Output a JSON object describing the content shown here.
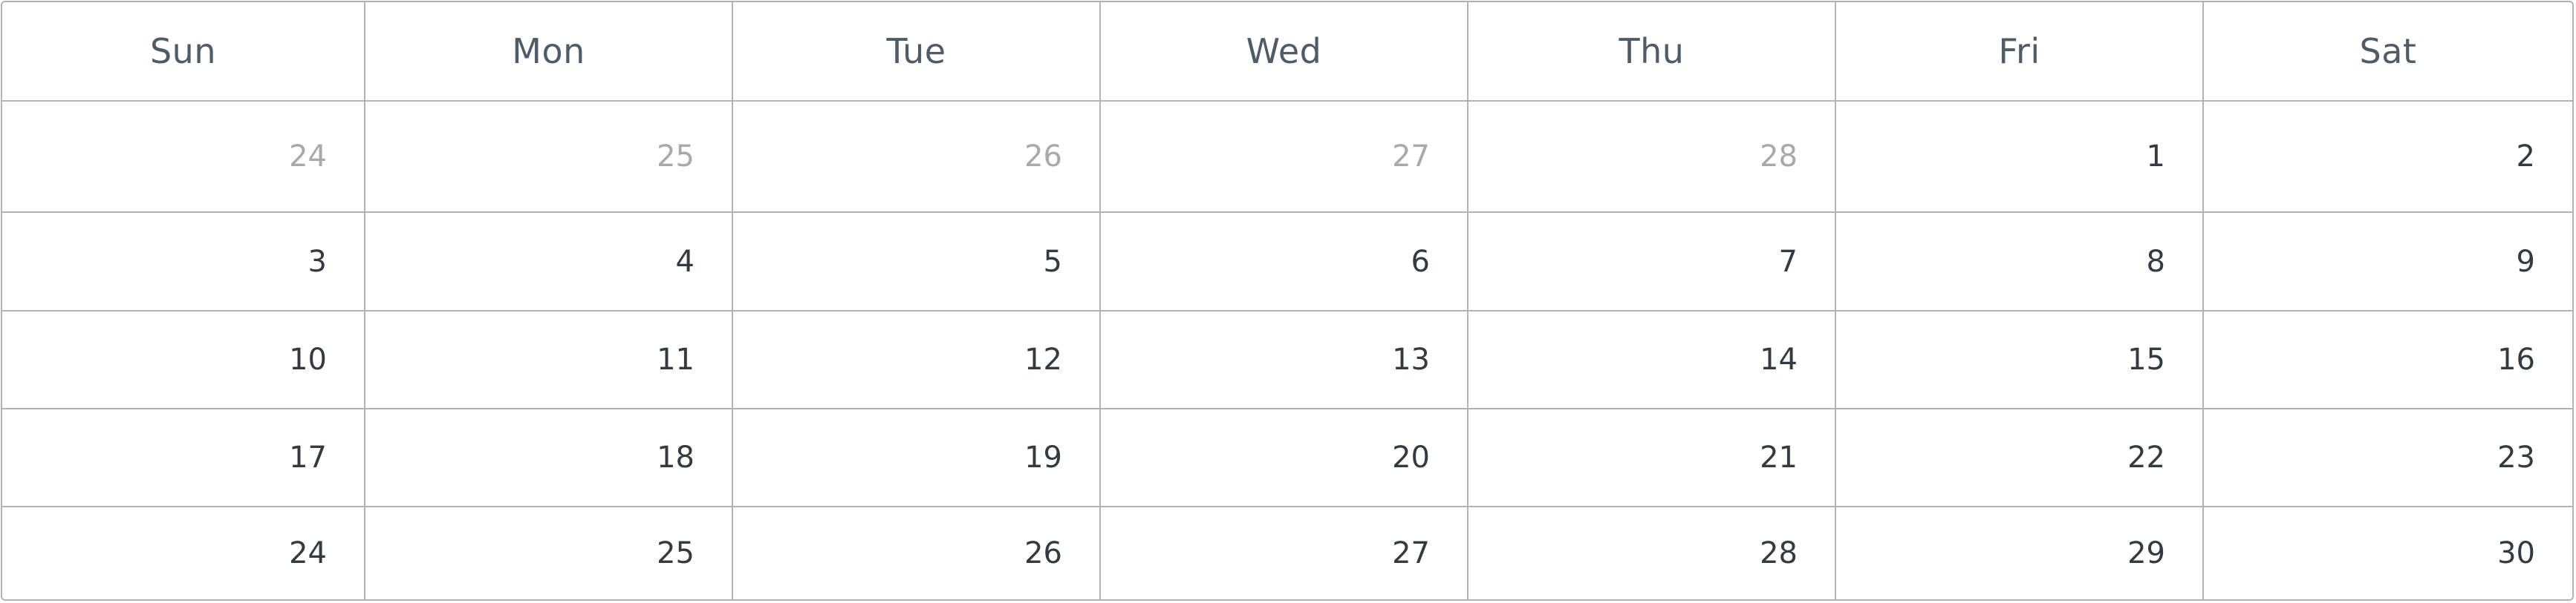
{
  "calendar": {
    "weekdays": [
      "Sun",
      "Mon",
      "Tue",
      "Wed",
      "Thu",
      "Fri",
      "Sat"
    ],
    "weeks": [
      [
        {
          "day": "24",
          "muted": true
        },
        {
          "day": "25",
          "muted": true
        },
        {
          "day": "26",
          "muted": true
        },
        {
          "day": "27",
          "muted": true
        },
        {
          "day": "28",
          "muted": true
        },
        {
          "day": "1",
          "muted": false
        },
        {
          "day": "2",
          "muted": false
        }
      ],
      [
        {
          "day": "3",
          "muted": false
        },
        {
          "day": "4",
          "muted": false
        },
        {
          "day": "5",
          "muted": false
        },
        {
          "day": "6",
          "muted": false
        },
        {
          "day": "7",
          "muted": false
        },
        {
          "day": "8",
          "muted": false
        },
        {
          "day": "9",
          "muted": false
        }
      ],
      [
        {
          "day": "10",
          "muted": false
        },
        {
          "day": "11",
          "muted": false
        },
        {
          "day": "12",
          "muted": false
        },
        {
          "day": "13",
          "muted": false
        },
        {
          "day": "14",
          "muted": false
        },
        {
          "day": "15",
          "muted": false
        },
        {
          "day": "16",
          "muted": false
        }
      ],
      [
        {
          "day": "17",
          "muted": false
        },
        {
          "day": "18",
          "muted": false
        },
        {
          "day": "19",
          "muted": false
        },
        {
          "day": "20",
          "muted": false
        },
        {
          "day": "21",
          "muted": false
        },
        {
          "day": "22",
          "muted": false
        },
        {
          "day": "23",
          "muted": false
        }
      ],
      [
        {
          "day": "24",
          "muted": false
        },
        {
          "day": "25",
          "muted": false
        },
        {
          "day": "26",
          "muted": false
        },
        {
          "day": "27",
          "muted": false
        },
        {
          "day": "28",
          "muted": false
        },
        {
          "day": "29",
          "muted": false
        },
        {
          "day": "30",
          "muted": false
        }
      ]
    ]
  }
}
